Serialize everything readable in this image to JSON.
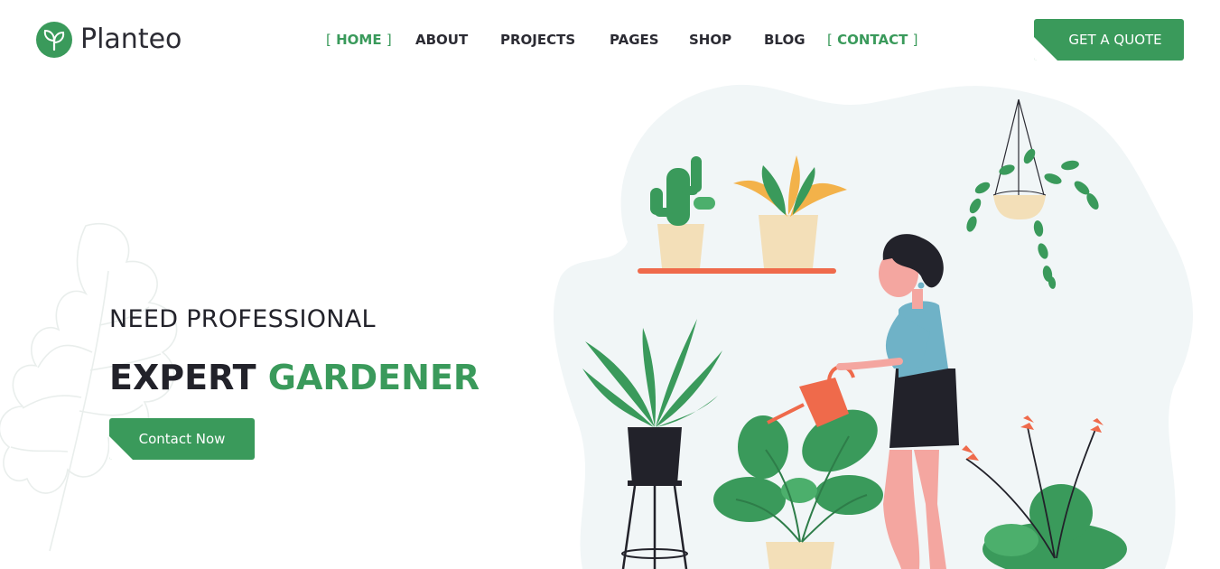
{
  "brand": {
    "name": "Planteo",
    "logo_icon": "sprout-leaf-icon",
    "accent_color": "#3a9a5b",
    "dark_color": "#22222a",
    "pot_accent_color": "#ef6a4b"
  },
  "nav": {
    "items": [
      {
        "label": "HOME",
        "active": true
      },
      {
        "label": "ABOUT",
        "active": false
      },
      {
        "label": "PROJECTS",
        "active": false
      },
      {
        "label": "PAGES",
        "active": false
      },
      {
        "label": "SHOP",
        "active": false
      },
      {
        "label": "BLOG",
        "active": false
      },
      {
        "label": "CONTACT",
        "active": true
      }
    ],
    "bracket_open": "[",
    "bracket_close": "]"
  },
  "header": {
    "cta_label": "GET A QUOTE"
  },
  "hero": {
    "subtitle": "NEED PROFESSIONAL",
    "title_dark": "EXPERT",
    "title_accent": "GARDENER",
    "button_label": "Contact Now"
  }
}
